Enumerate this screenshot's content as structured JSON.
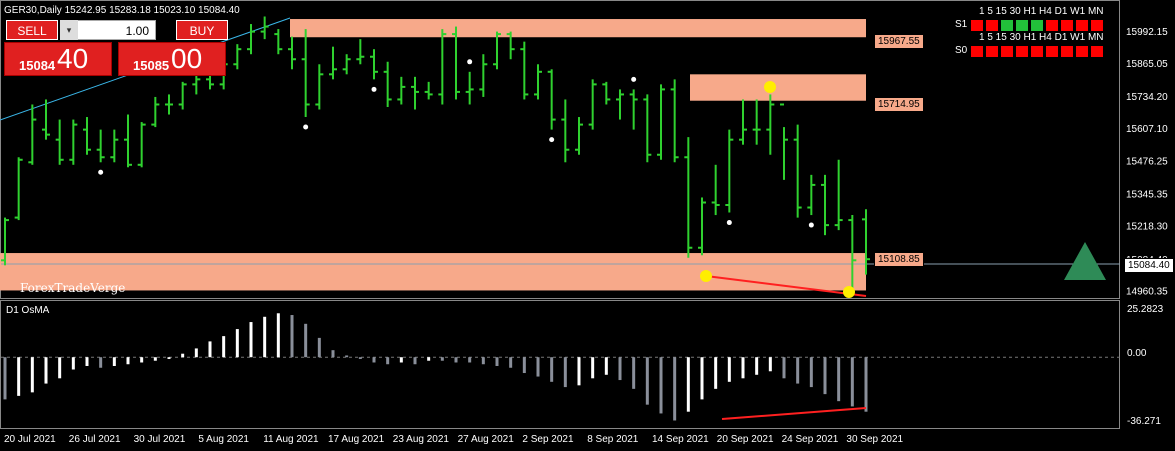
{
  "header": {
    "symbol_info": "GER30,Daily  15242.95 15283.18 15023.10 15084.40"
  },
  "trade_panel": {
    "sell_label": "SELL",
    "buy_label": "BUY",
    "lot_value": "1.00",
    "sell_price_small": "15084",
    "sell_price_big": "40",
    "buy_price_small": "15085",
    "buy_price_big": "00",
    "colors": {
      "button": "#e02020"
    }
  },
  "watermark": "ForexTradeVerge",
  "mtf": {
    "timeframes": [
      "1",
      "5",
      "15",
      "30",
      "H1",
      "H4",
      "D1",
      "W1",
      "MN"
    ],
    "rows": [
      {
        "label": "S1",
        "states": [
          "red",
          "red",
          "green",
          "green",
          "green",
          "red",
          "red",
          "red",
          "red"
        ]
      },
      {
        "label": "S0",
        "states": [
          "red",
          "red",
          "red",
          "red",
          "red",
          "red",
          "red",
          "red",
          "red"
        ]
      }
    ],
    "colors": {
      "red": "#ff0000",
      "green": "#22c03a"
    }
  },
  "zone_labels": [
    "15967.55",
    "15714.95",
    "15108.85"
  ],
  "current_price_tag": "15084.40",
  "indicator": {
    "name": "D1 OsMA",
    "axis_labels": [
      "25.2823",
      "0.00",
      "-36.271"
    ]
  },
  "chart_data": {
    "type": "bar",
    "title": "GER30,Daily",
    "price_axis_labels": [
      "15992.15",
      "15865.05",
      "15734.20",
      "15607.10",
      "15476.25",
      "15345.35",
      "15218.30",
      "15084.40",
      "14960.35"
    ],
    "ylim": [
      14930,
      16060
    ],
    "x_tick_labels": [
      "20 Jul 2021",
      "26 Jul 2021",
      "30 Jul 2021",
      "5 Aug 2021",
      "11 Aug 2021",
      "17 Aug 2021",
      "23 Aug 2021",
      "27 Aug 2021",
      "2 Sep 2021",
      "8 Sep 2021",
      "14 Sep 2021",
      "20 Sep 2021",
      "24 Sep 2021",
      "30 Sep 2021"
    ],
    "last": {
      "open": 15242.95,
      "high": 15283.18,
      "low": 15023.1,
      "close": 15084.4
    },
    "zones": [
      {
        "low": 15967.55,
        "high": 16040,
        "color": "#f7a98a"
      },
      {
        "low": 15714.95,
        "high": 15820,
        "color": "#f7a98a"
      },
      {
        "low": 14960,
        "high": 15108.85,
        "color": "#f7a98a"
      }
    ],
    "bars": [
      [
        15080,
        15250,
        15060,
        15240
      ],
      [
        15250,
        15490,
        15240,
        15480
      ],
      [
        15470,
        15700,
        15460,
        15640
      ],
      [
        15600,
        15720,
        15560,
        15580
      ],
      [
        15560,
        15640,
        15460,
        15480
      ],
      [
        15480,
        15640,
        15460,
        15620
      ],
      [
        15600,
        15650,
        15500,
        15520
      ],
      [
        15520,
        15600,
        15470,
        15490
      ],
      [
        15490,
        15600,
        15470,
        15560
      ],
      [
        15560,
        15660,
        15450,
        15460
      ],
      [
        15460,
        15630,
        15450,
        15620
      ],
      [
        15620,
        15730,
        15610,
        15700
      ],
      [
        15700,
        15740,
        15660,
        15700
      ],
      [
        15700,
        15790,
        15680,
        15780
      ],
      [
        15780,
        15840,
        15740,
        15800
      ],
      [
        15800,
        15870,
        15760,
        15780
      ],
      [
        15780,
        15880,
        15760,
        15860
      ],
      [
        15860,
        15940,
        15840,
        15920
      ],
      [
        15920,
        16020,
        15900,
        15990
      ],
      [
        15990,
        16050,
        15960,
        16010
      ],
      [
        15980,
        16000,
        15900,
        15920
      ],
      [
        15920,
        15970,
        15840,
        15880
      ],
      [
        15880,
        16000,
        15650,
        15700
      ],
      [
        15700,
        15860,
        15680,
        15820
      ],
      [
        15820,
        15930,
        15800,
        15840
      ],
      [
        15840,
        15900,
        15820,
        15880
      ],
      [
        15880,
        15960,
        15860,
        15890
      ],
      [
        15890,
        15920,
        15800,
        15830
      ],
      [
        15830,
        15870,
        15690,
        15720
      ],
      [
        15720,
        15810,
        15700,
        15770
      ],
      [
        15770,
        15810,
        15680,
        15750
      ],
      [
        15750,
        15790,
        15720,
        15740
      ],
      [
        15740,
        16000,
        15700,
        15980
      ],
      [
        15980,
        16010,
        15720,
        15750
      ],
      [
        15750,
        15830,
        15700,
        15760
      ],
      [
        15760,
        15900,
        15730,
        15860
      ],
      [
        15860,
        15990,
        15840,
        15980
      ],
      [
        15980,
        15990,
        15880,
        15920
      ],
      [
        15920,
        15950,
        15720,
        15740
      ],
      [
        15740,
        15860,
        15720,
        15830
      ],
      [
        15830,
        15840,
        15600,
        15640
      ],
      [
        15640,
        15720,
        15470,
        15520
      ],
      [
        15520,
        15650,
        15500,
        15620
      ],
      [
        15620,
        15800,
        15600,
        15780
      ],
      [
        15780,
        15790,
        15700,
        15720
      ],
      [
        15720,
        15760,
        15640,
        15740
      ],
      [
        15740,
        15760,
        15600,
        15720
      ],
      [
        15720,
        15740,
        15470,
        15500
      ],
      [
        15500,
        15780,
        15480,
        15760
      ],
      [
        15760,
        15800,
        15470,
        15490
      ],
      [
        15490,
        15570,
        15090,
        15130
      ],
      [
        15130,
        15330,
        15100,
        15310
      ],
      [
        15310,
        15460,
        15260,
        15300
      ],
      [
        15300,
        15600,
        15270,
        15560
      ],
      [
        15560,
        15720,
        15540,
        15600
      ],
      [
        15600,
        15720,
        15540,
        15600
      ],
      [
        15600,
        15740,
        15500,
        15700
      ],
      [
        15700,
        15610,
        15400,
        15560
      ],
      [
        15560,
        15620,
        15250,
        15290
      ],
      [
        15290,
        15420,
        15260,
        15380
      ],
      [
        15380,
        15420,
        15180,
        15220
      ],
      [
        15220,
        15480,
        15200,
        15240
      ],
      [
        15240,
        15260,
        14960,
        15080
      ],
      [
        15242.95,
        15283.18,
        15023.1,
        15084.4
      ]
    ],
    "osma": [
      -24,
      -22,
      -20,
      -15,
      -12,
      -7,
      -5,
      -6,
      -5,
      -4,
      -3,
      -2,
      -1,
      2,
      5,
      9,
      12,
      16,
      20,
      23,
      25,
      24,
      19,
      11,
      4,
      1,
      -1,
      -3,
      -4,
      -3,
      -4,
      -2,
      -2,
      -3,
      -3,
      -4,
      -5,
      -6,
      -9,
      -11,
      -14,
      -17,
      -16,
      -12,
      -10,
      -13,
      -18,
      -27,
      -32,
      -36,
      -31,
      -24,
      -18,
      -14,
      -12,
      -10,
      -8,
      -12,
      -15,
      -17,
      -21,
      -25,
      -28,
      -31
    ],
    "osma_ylim": [
      -38,
      28
    ]
  }
}
